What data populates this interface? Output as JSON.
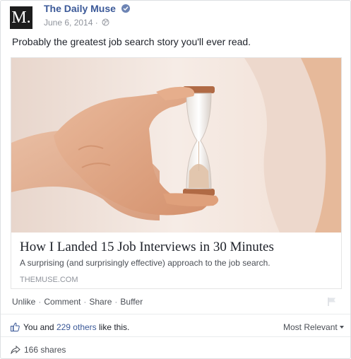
{
  "post": {
    "page_name": "The Daily Muse",
    "avatar_letter": "M.",
    "date": "June 6, 2014",
    "separator": "·",
    "status_text": "Probably the greatest job search story you'll ever read.",
    "link": {
      "title": "How I Landed 15 Job Interviews in 30 Minutes",
      "description": "A surprising (and surprisingly effective) approach to the job search.",
      "domain": "THEMUSE.COM"
    },
    "actions": {
      "unlike": "Unlike",
      "comment": "Comment",
      "share": "Share",
      "buffer": "Buffer",
      "dot": "·"
    },
    "likes": {
      "prefix": "You and ",
      "count": "229 others",
      "suffix": " like this."
    },
    "sort_label": "Most Relevant",
    "shares": "166 shares"
  },
  "colors": {
    "link_blue": "#3b5998",
    "meta_gray": "#90949c",
    "text_dark": "#1d2129",
    "avatar_bg": "#1d1d1d"
  },
  "icons": [
    "verified-badge-icon",
    "globe-icon",
    "flag-icon",
    "thumbs-up-icon",
    "share-arrow-icon"
  ]
}
